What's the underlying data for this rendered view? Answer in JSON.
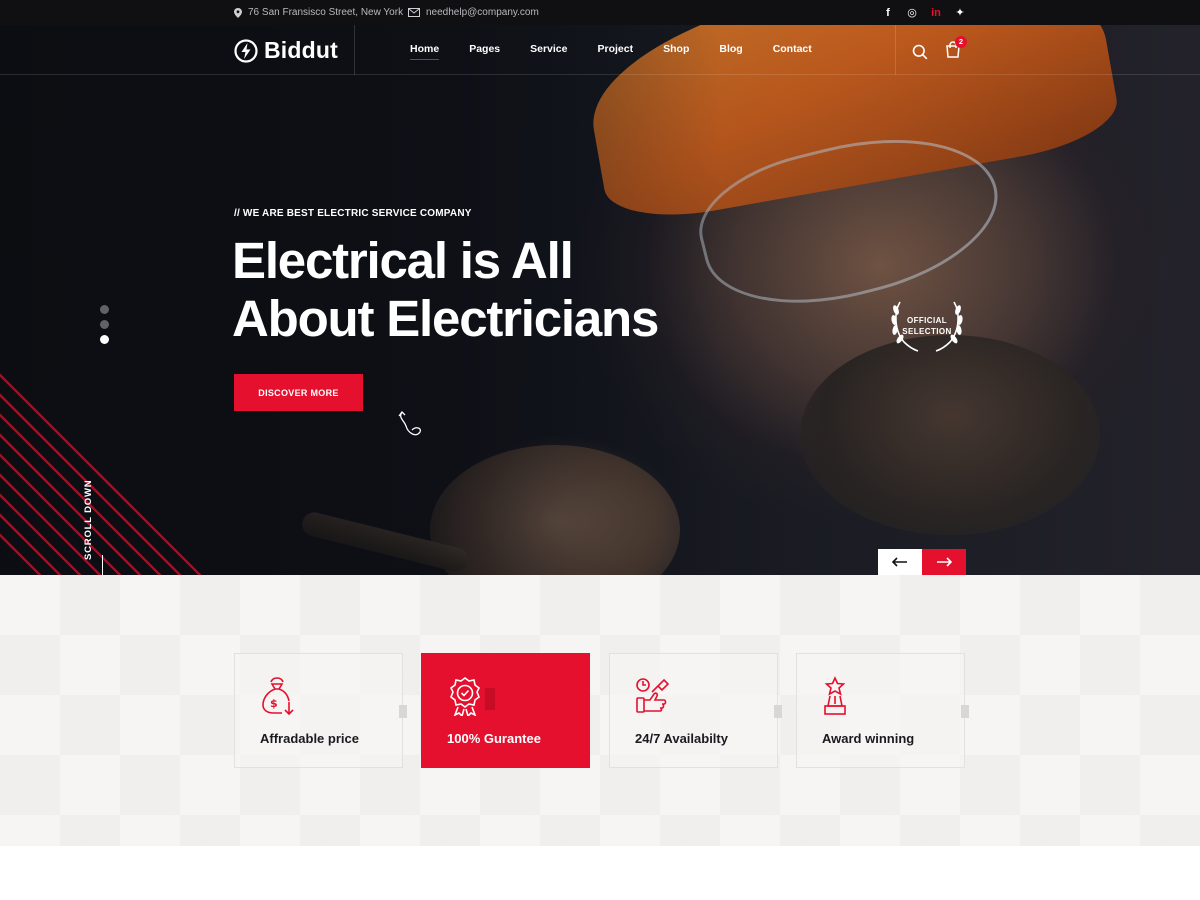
{
  "topbar": {
    "address": "76 San Fransisco Street, New York",
    "email": "needhelp@company.com",
    "socials": [
      {
        "icon": "facebook-icon",
        "glyph": "f"
      },
      {
        "icon": "instagram-icon",
        "glyph": "◎"
      },
      {
        "icon": "linkedin-icon",
        "glyph": "in"
      },
      {
        "icon": "twitter-icon",
        "glyph": "✦"
      }
    ]
  },
  "header": {
    "logo_text": "Biddut",
    "menu": [
      "Home",
      "Pages",
      "Service",
      "Project",
      "Shop",
      "Blog",
      "Contact"
    ],
    "active_menu": "Home",
    "cart_count": "2"
  },
  "hero": {
    "tagline": "// WE ARE BEST ELECTRIC SERVICE COMPANY",
    "headline_line1": "Electrical is All",
    "headline_line2": "About Electricians",
    "cta_label": "DISCOVER MORE",
    "badge_line1": "OFFICIAL",
    "badge_line2": "SELECTION",
    "scroll_label": "SCROLL DOWN",
    "slides": 3,
    "active_slide": 3
  },
  "features": [
    {
      "title": "Affradable price",
      "icon": "money-bag-icon",
      "active": false
    },
    {
      "title": "100% Gurantee",
      "icon": "badge-check-icon",
      "active": true
    },
    {
      "title": "24/7 Availabilty",
      "icon": "support-hand-icon",
      "active": false
    },
    {
      "title": "Award winning",
      "icon": "trophy-icon",
      "active": false
    }
  ],
  "colors": {
    "accent": "#e4102e",
    "dark": "#101012",
    "section_bg": "#f6f5f3"
  }
}
